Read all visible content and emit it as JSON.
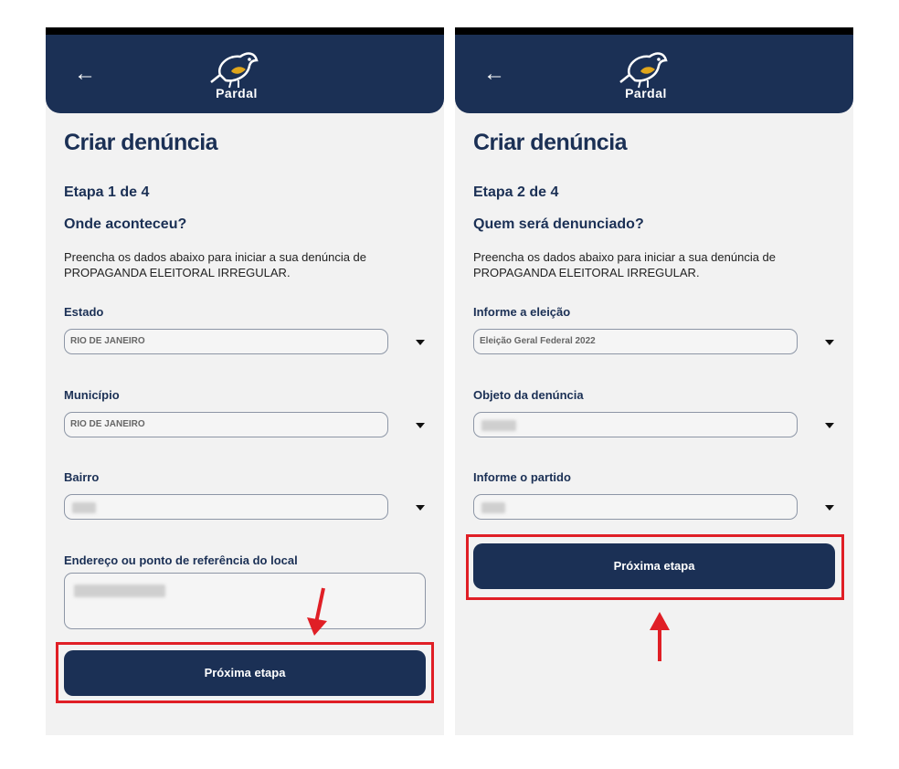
{
  "colors": {
    "navy": "#1b3055",
    "highlight": "#e01f26",
    "background": "#f2f2f2",
    "logo_accent": "#e0a61c"
  },
  "app": {
    "logo_text": "Pardal",
    "back_icon": "arrow-left-icon"
  },
  "screens": [
    {
      "title": "Criar denúncia",
      "step": "Etapa 1 de 4",
      "question": "Onde aconteceu?",
      "description": "Preencha os dados abaixo para iniciar a sua denúncia de PROPAGANDA ELEITORAL IRREGULAR.",
      "fields": [
        {
          "label": "Estado",
          "value": "RIO DE JANEIRO"
        },
        {
          "label": "Município",
          "value": "RIO DE JANEIRO"
        },
        {
          "label": "Bairro",
          "value": ""
        }
      ],
      "address_label": "Endereço ou ponto de referência do local",
      "address_value": "",
      "button": "Próxima etapa"
    },
    {
      "title": "Criar denúncia",
      "step": "Etapa 2 de 4",
      "question": "Quem será denunciado?",
      "description": "Preencha os dados abaixo para iniciar a sua denúncia de PROPAGANDA ELEITORAL IRREGULAR.",
      "fields": [
        {
          "label": "Informe a eleição",
          "value": "Eleição Geral Federal 2022"
        },
        {
          "label": "Objeto da denúncia",
          "value": ""
        },
        {
          "label": "Informe o partido",
          "value": ""
        }
      ],
      "button": "Próxima etapa"
    }
  ]
}
